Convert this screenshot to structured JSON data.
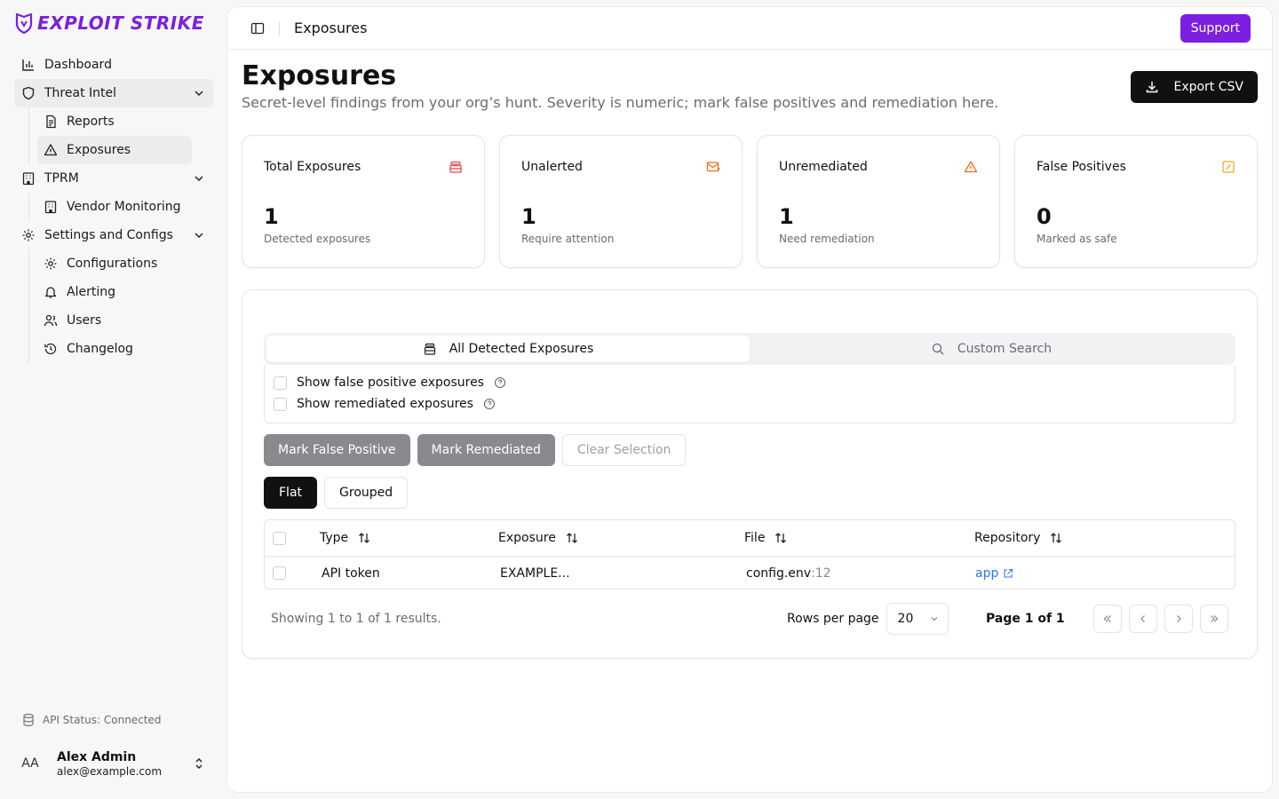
{
  "brand": {
    "name": "EXPLOIT STRIKE",
    "color": "#7c1fe0"
  },
  "sidebar": {
    "items": [
      {
        "label": "Dashboard",
        "icon": "bar-chart-icon"
      },
      {
        "label": "Threat Intel",
        "icon": "shield-icon",
        "expanded": true,
        "children": [
          {
            "label": "Reports",
            "icon": "file-text-icon"
          },
          {
            "label": "Exposures",
            "icon": "alert-triangle-icon",
            "active": true
          }
        ]
      },
      {
        "label": "TPRM",
        "icon": "building-icon",
        "expanded": true,
        "children": [
          {
            "label": "Vendor Monitoring",
            "icon": "building-icon"
          }
        ]
      },
      {
        "label": "Settings and Configs",
        "icon": "gear-icon",
        "expanded": true,
        "children": [
          {
            "label": "Configurations",
            "icon": "gear-icon"
          },
          {
            "label": "Alerting",
            "icon": "bell-icon"
          },
          {
            "label": "Users",
            "icon": "users-icon"
          },
          {
            "label": "Changelog",
            "icon": "history-icon"
          }
        ]
      }
    ],
    "api_status": "API Status: Connected",
    "user": {
      "initials": "AA",
      "name": "Alex Admin",
      "email": "alex@example.com"
    }
  },
  "topbar": {
    "title": "Exposures",
    "support_label": "Support"
  },
  "header": {
    "title": "Exposures",
    "subtitle": "Secret-level findings from your org’s hunt. Severity is numeric; mark false positives and remediation here.",
    "export_label": "Export CSV"
  },
  "stats": [
    {
      "label": "Total Exposures",
      "value": "1",
      "note": "Detected exposures",
      "icon": "database-icon",
      "color": "#e5484d"
    },
    {
      "label": "Unalerted",
      "value": "1",
      "note": "Require attention",
      "icon": "mail-alert-icon",
      "color": "#f76b15"
    },
    {
      "label": "Unremediated",
      "value": "1",
      "note": "Need remediation",
      "icon": "alert-triangle-icon",
      "color": "#f76b15"
    },
    {
      "label": "False Positives",
      "value": "0",
      "note": "Marked as safe",
      "icon": "check-square-icon",
      "color": "#f5a524"
    }
  ],
  "tabs": [
    {
      "label": "All Detected Exposures",
      "active": true
    },
    {
      "label": "Custom Search",
      "active": false
    }
  ],
  "filters": {
    "false_positive_label": "Show false positive exposures",
    "remediated_label": "Show remediated exposures"
  },
  "actions": {
    "mark_fp": "Mark False Positive",
    "mark_remediated": "Mark Remediated",
    "clear_selection": "Clear Selection"
  },
  "view": {
    "flat": "Flat",
    "grouped": "Grouped"
  },
  "table": {
    "columns": [
      "Type",
      "Exposure",
      "File",
      "Repository"
    ],
    "rows": [
      {
        "type": "API token",
        "exposure": "EXAMPLE...",
        "file": "config.env",
        "line": ":12",
        "repo": "app"
      }
    ]
  },
  "pagination": {
    "showing": "Showing 1 to 1 of 1 results.",
    "rows_per_page_label": "Rows per page",
    "rows_per_page": "20",
    "page": "Page 1 of 1"
  }
}
